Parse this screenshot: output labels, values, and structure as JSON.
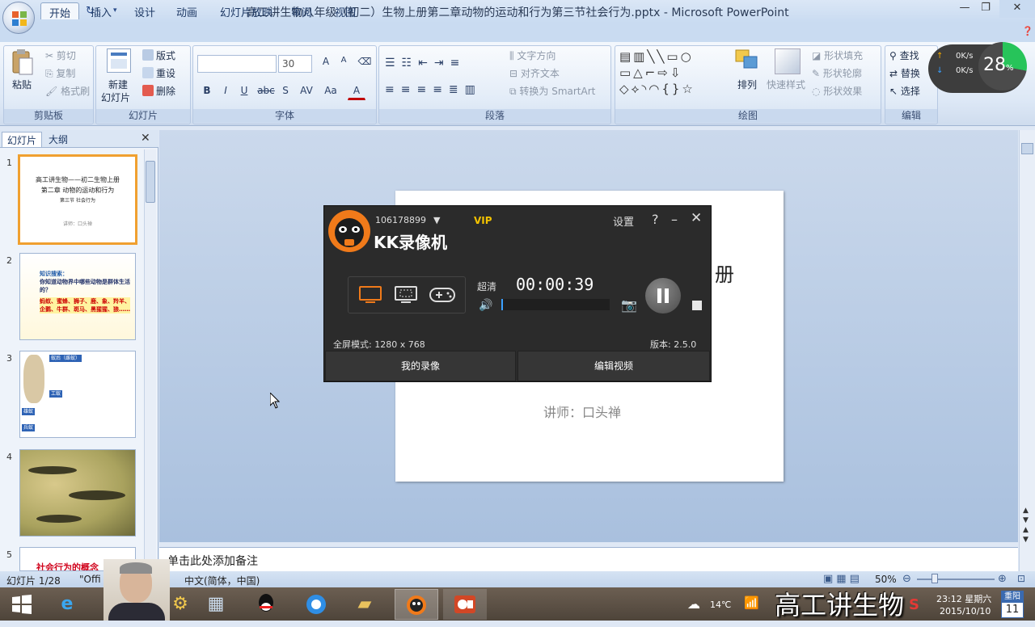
{
  "window": {
    "title": "高工讲生物八年级（初二）生物上册第二章动物的运动和行为第三节社会行为.pptx - Microsoft PowerPoint"
  },
  "tabs": [
    "开始",
    "插入",
    "设计",
    "动画",
    "幻灯片放映",
    "审阅",
    "视图"
  ],
  "ribbon": {
    "clipboard": {
      "label": "剪贴板",
      "paste": "粘贴",
      "cut": "剪切",
      "copy": "复制",
      "format_painter": "格式刷"
    },
    "slides": {
      "label": "幻灯片",
      "new_slide": "新建",
      "new_slide2": "幻灯片",
      "layout": "版式",
      "reset": "重设",
      "delete": "删除"
    },
    "font": {
      "label": "字体",
      "size": "30",
      "bold": "B",
      "italic": "I",
      "underline": "U",
      "strike": "abc",
      "shadow": "S",
      "spacing": "AV",
      "case": "Aa",
      "color": "A",
      "grow": "A",
      "shrink": "A"
    },
    "paragraph": {
      "label": "段落",
      "text_direction": "文字方向",
      "align_text": "对齐文本",
      "convert_smartart": "转换为 SmartArt"
    },
    "drawing": {
      "label": "绘图",
      "arrange": "排列",
      "quick_styles": "快速样式",
      "shape_fill": "形状填充",
      "shape_outline": "形状轮廓",
      "shape_effects": "形状效果"
    },
    "editing": {
      "label": "编辑",
      "find": "查找",
      "replace": "替换",
      "select": "选择"
    }
  },
  "net_widget": {
    "up": "0K/s",
    "down": "0K/s",
    "percent": "28",
    "percent_sign": "%",
    "percent_value": 0.28
  },
  "left_panel": {
    "tabs": [
      "幻灯片",
      "大纲"
    ],
    "thumbnails": [
      {
        "num": "1",
        "lines": [
          "高工讲生物——初二生物上册",
          "第二章 动物的运动和行为",
          "第三节 社会行为",
          "讲师：口头禅"
        ]
      },
      {
        "num": "2",
        "lines": [
          "知识搜索：",
          "你知道动物界中哪些动物是群体生活的？",
          "蚂蚁、蜜蜂、狮子、鹿、象、羚羊、企鹅、牛群、斑马、黑猩猩、狼……"
        ]
      },
      {
        "num": "3",
        "lines": [
          "蚁后（雌蚁）",
          "工蚁",
          "雄蚁",
          "兵蚁"
        ]
      },
      {
        "num": "4",
        "lines": []
      },
      {
        "num": "5",
        "lines": [
          "社会行为的概念"
        ]
      }
    ]
  },
  "slide": {
    "title_partial": "册",
    "lecturer": "讲师：口头禅"
  },
  "notes": {
    "placeholder": "单击此处添加备注"
  },
  "statusbar": {
    "slide": "幻灯片 1/28",
    "theme": "\"Offi",
    "language": "中文(简体，中国)",
    "zoom": "50%"
  },
  "kk": {
    "account": "106178899",
    "vip": "VIP",
    "app_name": "KK录像机",
    "settings": "设置",
    "help": "?",
    "quality": "超清",
    "timer": "00:00:39",
    "mode": "全屏模式: 1280 x 768",
    "version": "版本: 2.5.0",
    "my_recordings": "我的录像",
    "edit_video": "编辑视频"
  },
  "taskbar": {
    "weather": "14℃",
    "time": "23:12 星期六",
    "date": "2015/10/10",
    "cal_label": "重阳",
    "cal_day": "11"
  },
  "overlay": {
    "text": "高工讲生物"
  }
}
